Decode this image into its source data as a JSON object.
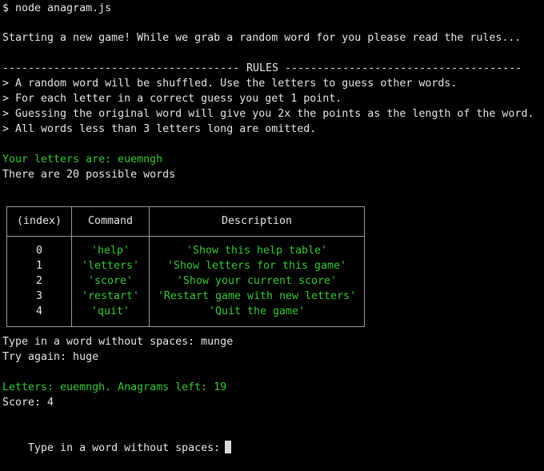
{
  "session": {
    "command_line": "$ node anagram.js",
    "start_message": "Starting a new game! While we grab a random word for you please read the rules...",
    "rules_title": "RULES",
    "rules": [
      "> A random word will be shuffled. Use the letters to guess other words.",
      "> For each letter in a correct guess you get 1 point.",
      "> Guessing the original word will give you 2x the points as the length of the word.",
      "> All words less than 3 letters long are omitted."
    ],
    "letters_line": "Your letters are: euemngh",
    "possible_words_line": "There are 20 possible words"
  },
  "table": {
    "headers": [
      "(index)",
      "Command",
      "Description"
    ],
    "rows": [
      {
        "index": "0",
        "command": "'help'",
        "description": "'Show this help table'"
      },
      {
        "index": "1",
        "command": "'letters'",
        "description": "'Show letters for this game'"
      },
      {
        "index": "2",
        "command": "'score'",
        "description": "'Show your current score'"
      },
      {
        "index": "3",
        "command": "'restart'",
        "description": "'Restart game with new letters'"
      },
      {
        "index": "4",
        "command": "'quit'",
        "description": "'Quit the game'"
      }
    ]
  },
  "history": {
    "prompt1": "Type in a word without spaces: munge",
    "retry": "Try again: huge",
    "status": "Letters: euemngh. Anagrams left: 19",
    "score": "Score: 4",
    "prompt2": "Type in a word without spaces:"
  },
  "colors": {
    "background": "#000000",
    "text": "#e6e6e6",
    "accent_green": "#32c832",
    "border": "#9a9a9a"
  }
}
